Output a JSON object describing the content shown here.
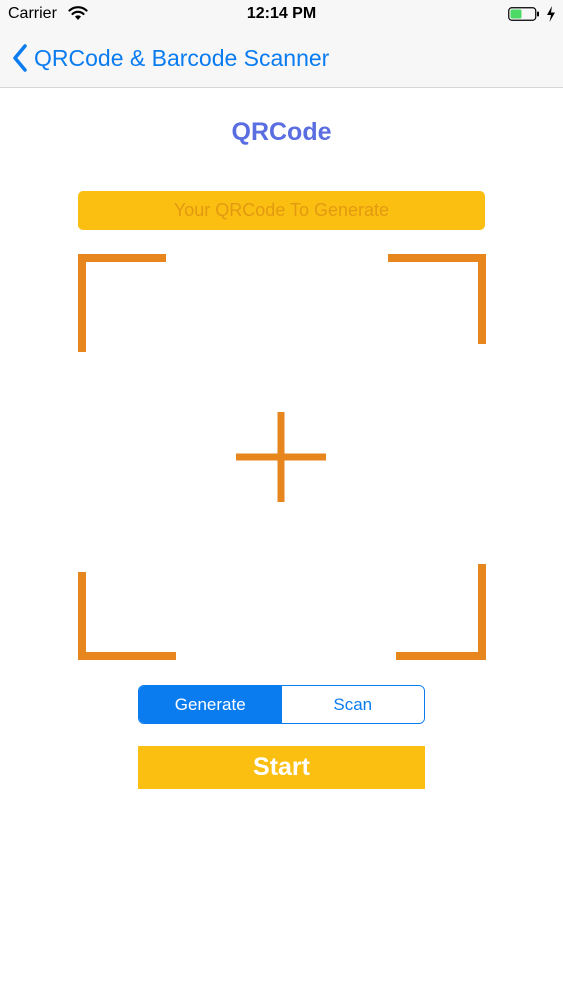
{
  "status_bar": {
    "carrier": "Carrier",
    "time": "12:14 PM",
    "icons": [
      "wifi-icon",
      "battery-icon",
      "charging-bolt-icon"
    ]
  },
  "nav": {
    "back_label": "QRCode & Barcode Scanner",
    "back_icon": "chevron-left-icon"
  },
  "main": {
    "title": "QRCode",
    "input": {
      "value": "",
      "placeholder": "Your QRCode To Generate"
    },
    "scanner_icon": "crosshair-icon",
    "segments": [
      {
        "label": "Generate",
        "selected": true
      },
      {
        "label": "Scan",
        "selected": false
      }
    ],
    "start_label": "Start"
  },
  "colors": {
    "accent_blue": "#0a7cf0",
    "title_blue": "#5b6ee1",
    "yellow": "#fbbf12",
    "frame_orange": "#e8861e"
  }
}
